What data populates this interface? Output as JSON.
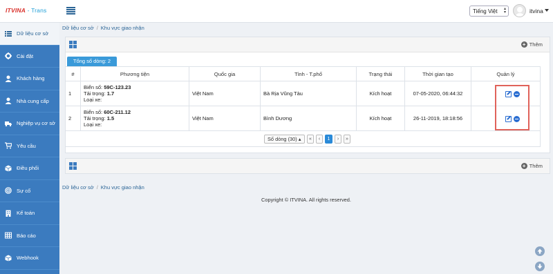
{
  "app": {
    "logo_brand": "ITVINA",
    "logo_suffix": " - Trans"
  },
  "header": {
    "language": "Tiếng Việt",
    "username": "itvina"
  },
  "sidebar": {
    "items": [
      {
        "label": "Dữ liệu cơ sở",
        "icon": "list-icon",
        "active": true
      },
      {
        "label": "Cài đặt",
        "icon": "gear-icon"
      },
      {
        "label": "Khách hàng",
        "icon": "user-icon"
      },
      {
        "label": "Nhà cung cấp",
        "icon": "user-icon"
      },
      {
        "label": "Nghiệp vụ cơ sở",
        "icon": "truck-icon"
      },
      {
        "label": "Yêu cầu",
        "icon": "cart-icon"
      },
      {
        "label": "Điều phối",
        "icon": "cube-icon"
      },
      {
        "label": "Sự cố",
        "icon": "target-icon"
      },
      {
        "label": "Kế toán",
        "icon": "building-icon"
      },
      {
        "label": "Báo cáo",
        "icon": "table-icon"
      },
      {
        "label": "Webhook",
        "icon": "cube-icon"
      }
    ]
  },
  "breadcrumb": {
    "root": "Dữ liệu cơ sở",
    "current": "Khu vực giao nhận"
  },
  "panel": {
    "add_label": "Thêm",
    "row_count_label": "Tổng số dòng: 2"
  },
  "table": {
    "headers": [
      "#",
      "Phương tiện",
      "Quốc gia",
      "Tỉnh - T.phố",
      "Trạng thái",
      "Thời gian tạo",
      "Quản lý"
    ],
    "plate_label": "Biển số:",
    "load_label": "Tải trọng:",
    "type_label": "Loại xe:",
    "rows": [
      {
        "index": "1",
        "plate": "59C-123.23",
        "load": "1.7",
        "type": "",
        "country": "Việt Nam",
        "province": "Bà Rịa Vũng Tàu",
        "status": "Kích hoạt",
        "created": "07-05-2020, 06:44:32"
      },
      {
        "index": "2",
        "plate": "60C-211.12",
        "load": "1.5",
        "type": "",
        "country": "Việt Nam",
        "province": "Bình Dương",
        "status": "Kích hoạt",
        "created": "26-11-2019, 18:18:56"
      }
    ]
  },
  "pager": {
    "rows_label": "Số dòng (30) ▴",
    "first": "«",
    "prev": "‹",
    "current_page": "1",
    "next": "›",
    "last": "»"
  },
  "footer": {
    "copyright": "Copyright © ITVINA. All rights reserved."
  },
  "colors": {
    "sidebar": "#3b7bbf",
    "accent": "#3a9ad9",
    "highlight": "#e0625a"
  }
}
